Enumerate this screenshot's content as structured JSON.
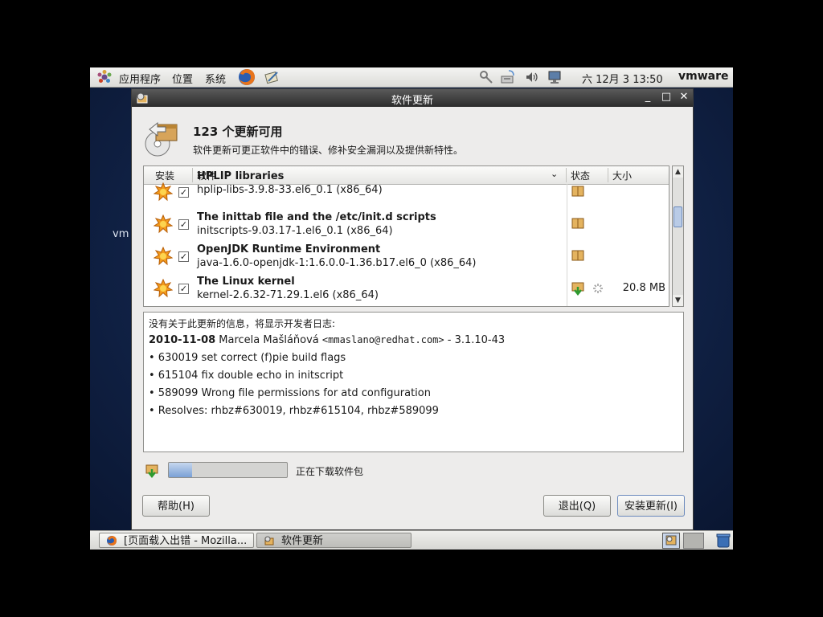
{
  "top_panel": {
    "menus": [
      "应用程序",
      "位置",
      "系统"
    ],
    "clock": "六 12月  3 13:50",
    "user": "vmware"
  },
  "desktop": {
    "label": "vm"
  },
  "window": {
    "title": "软件更新",
    "header_title": "123 个更新可用",
    "header_subtitle": "软件更新可更正软件中的错误、修补安全漏洞以及提供新特性。"
  },
  "table": {
    "columns": [
      "安装",
      "软件",
      "状态",
      "大小"
    ],
    "rows": [
      {
        "name": "HPLIP libraries",
        "version": "hplip-libs-3.9.8-33.el6_0.1 (x86_64)",
        "checked": true,
        "status": "package-icon",
        "size": ""
      },
      {
        "name": "The inittab file and the /etc/init.d scripts",
        "version": "initscripts-9.03.17-1.el6_0.1 (x86_64)",
        "checked": true,
        "status": "package-icon",
        "size": ""
      },
      {
        "name": "OpenJDK Runtime Environment",
        "version": "java-1.6.0-openjdk-1:1.6.0.0-1.36.b17.el6_0 (x86_64)",
        "checked": true,
        "status": "package-icon",
        "size": ""
      },
      {
        "name": "The Linux kernel",
        "version": "kernel-2.6.32-71.29.1.el6 (x86_64)",
        "checked": true,
        "status": "download-icon",
        "size": "20.8 MB"
      }
    ]
  },
  "details": {
    "notice": "没有关于此更新的信息，将显示开发者日志:",
    "date": "2010-11-08",
    "author": " Marcela Mašláňová ",
    "email": "<mmaslano@redhat.com>",
    "release": " - 3.1.10-43",
    "items": [
      "• 630019 set correct (f)pie build flags",
      "• 615104 fix double echo in initscript",
      "• 589099 Wrong file permissions for atd configuration",
      "• Resolves: rhbz#630019, rhbz#615104, rhbz#589099"
    ]
  },
  "progress": {
    "fraction": 0.2,
    "label": "正在下载软件包"
  },
  "buttons": {
    "help": "帮助(H)",
    "quit": "退出(Q)",
    "install": "安装更新(I)"
  },
  "taskbar": [
    "[页面载入出错 - Mozilla...",
    "软件更新"
  ],
  "colors": {
    "titlebar": "#3a3a3a",
    "selection": "#7aa0d6",
    "desktop": "#112348"
  }
}
